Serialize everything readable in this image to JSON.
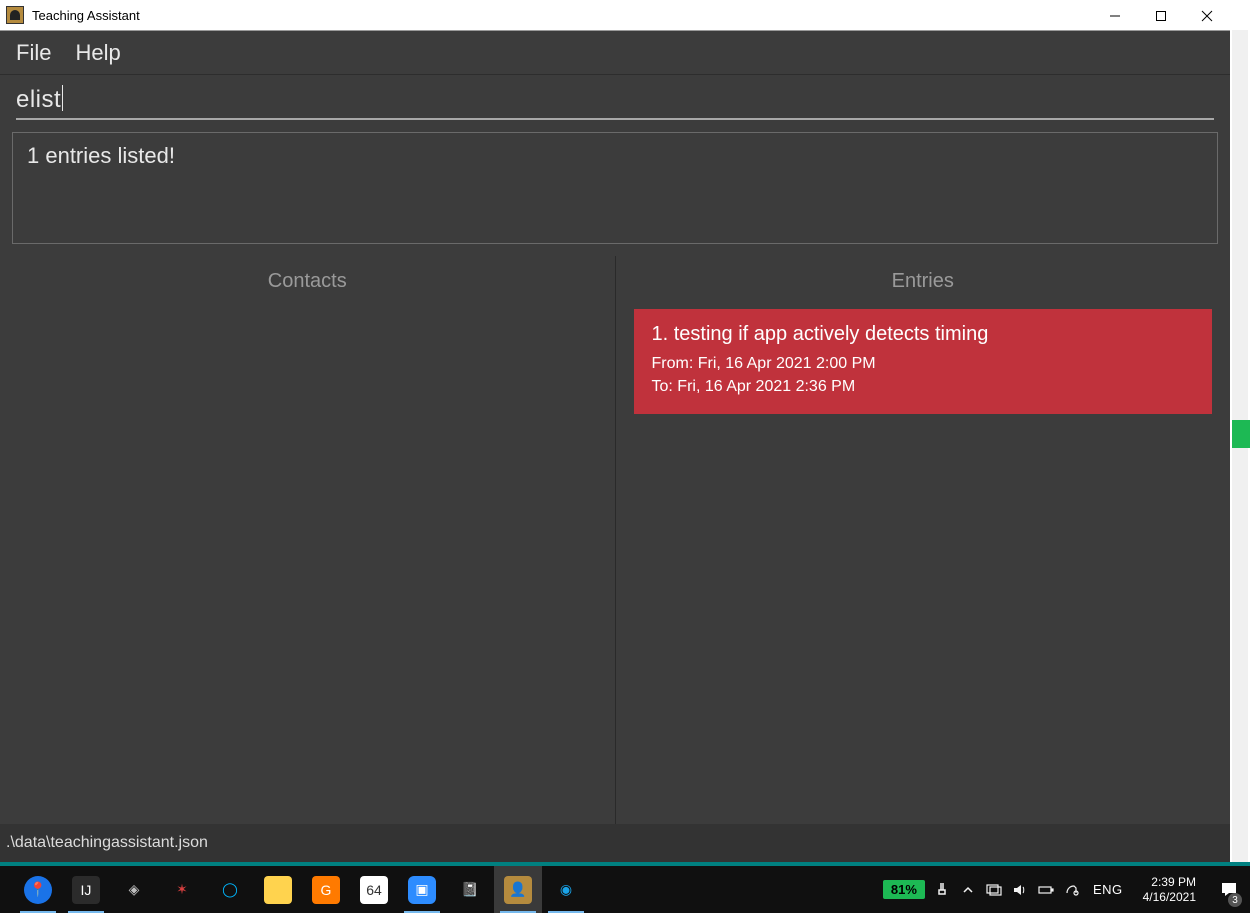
{
  "window": {
    "title": "Teaching Assistant"
  },
  "menu": {
    "file": "File",
    "help": "Help"
  },
  "command": {
    "value": "elist"
  },
  "status": {
    "message": "1 entries listed!"
  },
  "columns": {
    "contacts_header": "Contacts",
    "entries_header": "Entries"
  },
  "entries": [
    {
      "title": "1.   testing if app actively detects timing",
      "from": "From: Fri, 16 Apr 2021 2:00 PM",
      "to": "To: Fri, 16 Apr 2021 2:36 PM"
    }
  ],
  "footer": {
    "path": ".\\data\\teachingassistant.json"
  },
  "taskbar": {
    "battery": "81%",
    "language": "ENG",
    "time": "2:39 PM",
    "date": "4/16/2021",
    "notifications": "3"
  }
}
